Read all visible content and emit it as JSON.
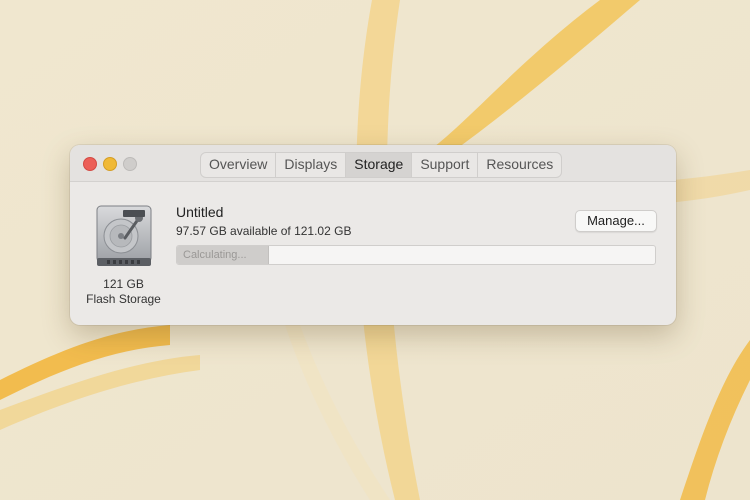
{
  "window": {
    "tabs": [
      {
        "label": "Overview",
        "active": false
      },
      {
        "label": "Displays",
        "active": false
      },
      {
        "label": "Storage",
        "active": true
      },
      {
        "label": "Support",
        "active": false
      },
      {
        "label": "Resources",
        "active": false
      }
    ]
  },
  "disk": {
    "icon": "hard-drive-icon",
    "size": "121 GB",
    "type": "Flash Storage"
  },
  "volume": {
    "name": "Untitled",
    "availability": "97.57 GB available of 121.02 GB",
    "manage_label": "Manage...",
    "bar_status": "Calculating...",
    "bar_fill_fraction": 0.19
  },
  "colors": {
    "close": "#ec5f57",
    "minimize": "#f0b936",
    "zoom_disabled": "#cfcdcb",
    "wallpaper_accent": "#f1b93c"
  }
}
